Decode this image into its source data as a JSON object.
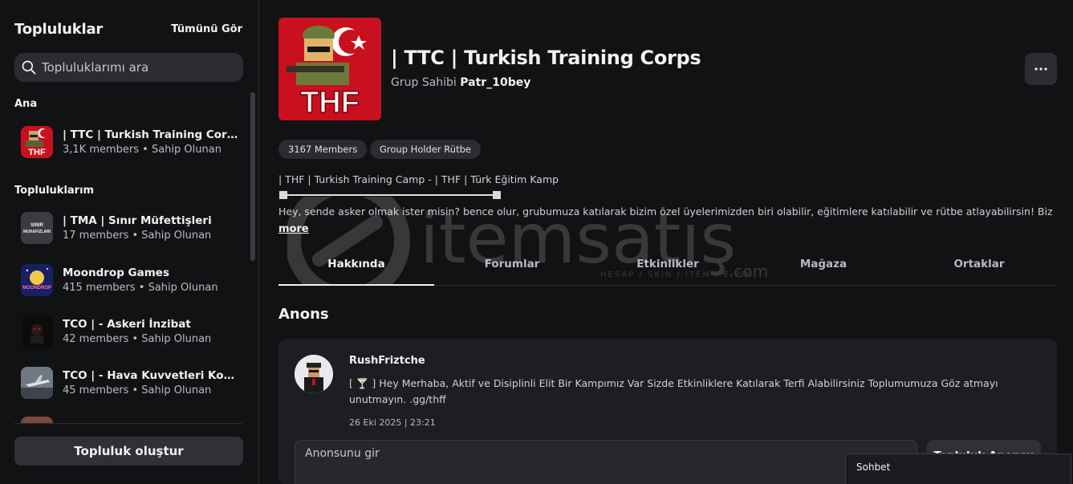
{
  "sidebar": {
    "title": "Topluluklar",
    "see_all": "Tümünü Gör",
    "search_placeholder": "Topluluklarımı ara",
    "section_main": "Ana",
    "section_mine": "Topluluklarım",
    "main_items": [
      {
        "name": "| TTC | Turkish Training Corps",
        "meta": "3,1K members • Sahip Olunan"
      }
    ],
    "my_items": [
      {
        "name": "| TMA | Sınır Müfettişleri",
        "meta": "17 members • Sahip Olunan",
        "thumb_text": "SINIR MUHAFIZLARI"
      },
      {
        "name": "Moondrop Games",
        "meta": "415 members • Sahip Olunan",
        "thumb_text": "MOONDROP"
      },
      {
        "name": "TCO | - Askeri İnzibat",
        "meta": "42 members • Sahip Olunan"
      },
      {
        "name": "TCO | - Hava Kuvvetleri Komuta...",
        "meta": "45 members • Sahip Olunan"
      }
    ],
    "create_button": "Topluluk oluştur"
  },
  "group": {
    "title": "| TTC | Turkish Training Corps",
    "owner_label": "Grup Sahibi",
    "owner_name": "Patr_10bey",
    "logo_text": "THF",
    "members_pill": "3167 Members",
    "rank_pill": "Group Holder Rütbe",
    "description_line1": "| THF | Turkish Training Camp - | THF | Türk Eğitim Kamp",
    "description_line2": "Hey, sende asker olmak ister misin? bence olur, grubumuza katılarak bizim özel üyelerimizden biri olabilir, eğitimlere katılabilir ve rütbe atlayabilirsin! Biz ...",
    "more_link": "more"
  },
  "tabs": [
    "Hakkında",
    "Forumlar",
    "Etkinlikler",
    "Mağaza",
    "Ortaklar"
  ],
  "watermark": {
    "brand": "itemsatış",
    "suffix": ".com",
    "tagline": "HESAP / SKIN / ITEM / E-PIN"
  },
  "announcement": {
    "heading": "Anons",
    "author": "RushFriztche",
    "body": "[ 🍸 ] Hey Merhaba, Aktif ve Disiplinli Elit Bir Kampımız Var Sizde Etkinliklere Katılarak Terfi Alabilirsiniz Toplumumuza Göz atmayı unutmayın. .gg/thff",
    "date": "26 Eki 2025 | 23:21",
    "input_placeholder": "Anonsunu gir",
    "action_button": "Topluluk Anonsu"
  },
  "chat": {
    "label": "Sohbet"
  },
  "colors": {
    "background": "#111214",
    "card": "#1d1e22",
    "pill": "#2a2c31",
    "logo_red": "#c8101e"
  }
}
